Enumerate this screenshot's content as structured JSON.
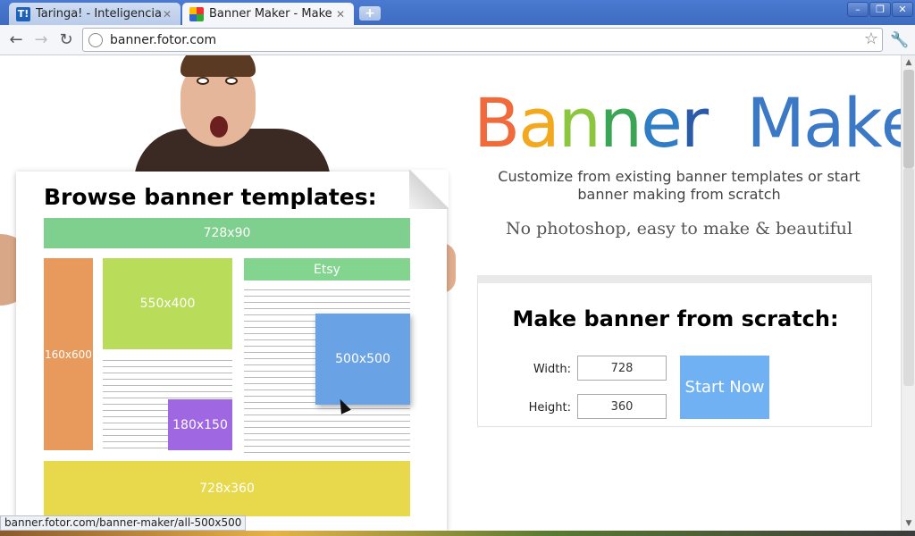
{
  "browser": {
    "tabs": [
      {
        "title": "Taringa! - Inteligencia...",
        "favicon": "T!"
      },
      {
        "title": "Banner Maker - Make ..."
      }
    ],
    "url": "banner.fotor.com",
    "status_url": "banner.fotor.com/banner-maker/all-500x500"
  },
  "page": {
    "browse_title": "Browse banner templates:",
    "templates": {
      "t728x90": "728x90",
      "t160x600": "160x600",
      "t550x400": "550x400",
      "etsy": "Etsy",
      "t500x500": "500x500",
      "t180x150": "180x150",
      "t728x360": "728x360"
    },
    "logo": {
      "letters": [
        "B",
        "a",
        "n",
        "n",
        "e",
        "r",
        " ",
        "M",
        "a",
        "k",
        "e",
        "r"
      ],
      "colors": [
        "#f06a3c",
        "#f2a91f",
        "#8cc63f",
        "#3aa655",
        "#2f7dc4",
        "#2b5aa8",
        "#ffffff",
        "#3b78c6",
        "#3b78c6",
        "#3b78c6",
        "#3b78c6",
        "#3b78c6"
      ]
    },
    "tagline": "Customize from existing banner templates or start banner making from scratch",
    "subtag": "No photoshop, easy to make & beautiful",
    "scratch": {
      "title": "Make banner from scratch:",
      "width_label": "Width:",
      "width_value": "728",
      "height_label": "Height:",
      "height_value": "360",
      "start_label": "Start Now"
    }
  }
}
